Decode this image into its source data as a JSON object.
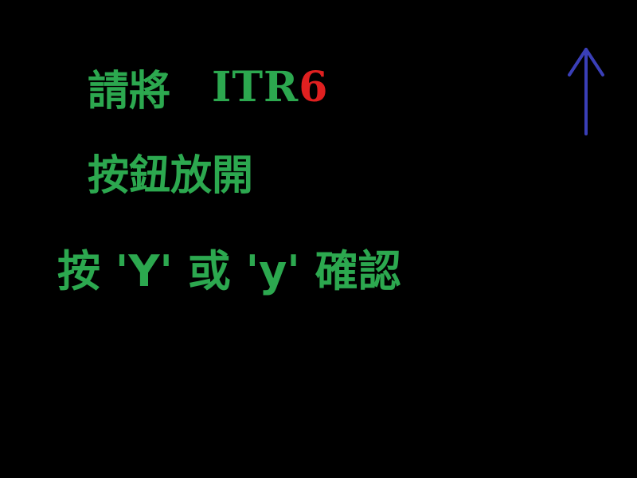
{
  "prompt": {
    "line1_prefix": "請將",
    "line1_code": "ITR",
    "line1_number": "6",
    "line2": "按鈕放開",
    "line3": "按 'Y' 或 'y' 確認"
  },
  "icons": {
    "direction": "up-arrow-icon"
  },
  "colors": {
    "background": "#000000",
    "text": "#2ca84f",
    "number_highlight": "#e02020",
    "arrow": "#3a3fb8"
  }
}
